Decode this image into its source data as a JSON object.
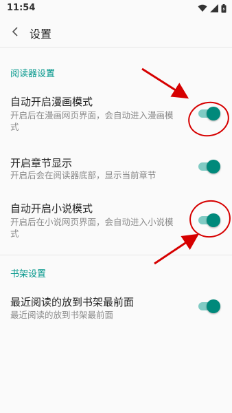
{
  "status_bar": {
    "time": "11:54",
    "icons": [
      "wifi-icon",
      "signal-icon",
      "battery-icon"
    ]
  },
  "toolbar": {
    "back_icon": "chevron-left-icon",
    "title": "设置"
  },
  "reader_section": {
    "header": "阅读器设置",
    "items": [
      {
        "title": "自动开启漫画模式",
        "summary": "开启后在漫画网页界面，会自动进入漫画模式",
        "enabled": true
      },
      {
        "title": "开启章节显示",
        "summary": "开启后会在阅读器底部，显示当前章节",
        "enabled": true
      },
      {
        "title": "自动开启小说模式",
        "summary": "开启后在小说网页界面，会自动进入小说模式",
        "enabled": true
      }
    ]
  },
  "shelf_section": {
    "header": "书架设置",
    "items": [
      {
        "title": "最近阅读的放到书架最前面",
        "summary": "最近阅读的放到书架最前面",
        "enabled": true
      }
    ]
  },
  "colors": {
    "accent": "#00968a",
    "switch_thumb": "#00897b",
    "switch_track": "#80cbc4",
    "annotation_red": "#d60000"
  }
}
